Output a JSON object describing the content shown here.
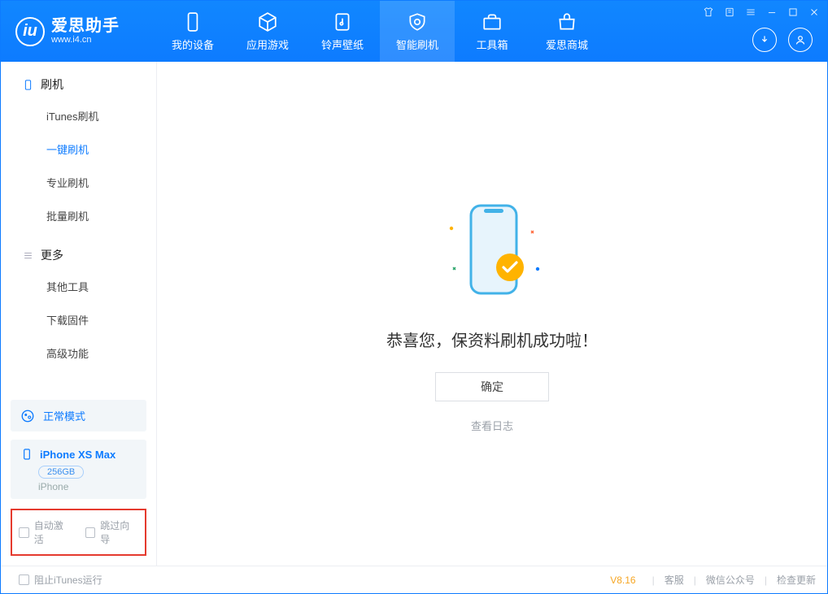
{
  "app": {
    "name": "爱思助手",
    "url": "www.i4.cn"
  },
  "tabs": [
    {
      "label": "我的设备"
    },
    {
      "label": "应用游戏"
    },
    {
      "label": "铃声壁纸"
    },
    {
      "label": "智能刷机"
    },
    {
      "label": "工具箱"
    },
    {
      "label": "爱思商城"
    }
  ],
  "sidebar": {
    "group_flash": "刷机",
    "flash_items": [
      "iTunes刷机",
      "一键刷机",
      "专业刷机",
      "批量刷机"
    ],
    "group_more": "更多",
    "more_items": [
      "其他工具",
      "下载固件",
      "高级功能"
    ]
  },
  "mode": {
    "label": "正常模式"
  },
  "device": {
    "name": "iPhone XS Max",
    "capacity": "256GB",
    "type": "iPhone"
  },
  "options": {
    "auto_activate": "自动激活",
    "skip_guide": "跳过向导"
  },
  "main": {
    "success_text": "恭喜您，保资料刷机成功啦！",
    "ok_button": "确定",
    "view_log": "查看日志"
  },
  "footer": {
    "block_itunes": "阻止iTunes运行",
    "version": "V8.16",
    "support": "客服",
    "wechat": "微信公众号",
    "check_update": "检查更新"
  }
}
